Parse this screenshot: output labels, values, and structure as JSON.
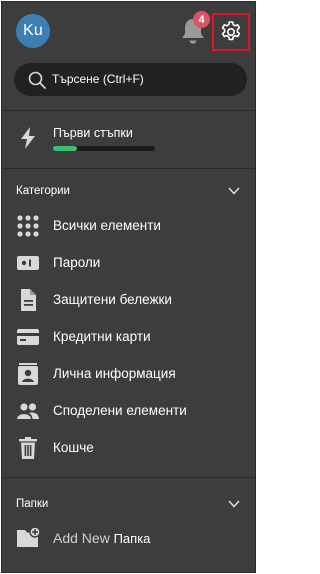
{
  "header": {
    "avatar_initials": "Ku",
    "notifications_count": "4",
    "bell_icon": "bell-icon",
    "settings_icon": "gear-icon"
  },
  "search": {
    "placeholder": "Търсене (Ctrl+F)",
    "icon": "search-icon"
  },
  "getting_started": {
    "label": "Първи стъпки",
    "icon": "lightning-icon",
    "progress_fraction": 0.24
  },
  "categories": {
    "title": "Категории",
    "items": [
      {
        "label": "Всички елементи",
        "icon": "grid-icon"
      },
      {
        "label": "Пароли",
        "icon": "password-icon"
      },
      {
        "label": "Защитени бележки",
        "icon": "note-icon"
      },
      {
        "label": "Кредитни карти",
        "icon": "credit-card-icon"
      },
      {
        "label": "Лична информация",
        "icon": "identity-icon"
      },
      {
        "label": "Споделени елементи",
        "icon": "shared-users-icon"
      },
      {
        "label": "Кошче",
        "icon": "trash-icon"
      }
    ]
  },
  "folders": {
    "title": "Папки",
    "add_new": "Add New",
    "add_new_suffix": "Папка",
    "icon": "folder-add-icon"
  },
  "colors": {
    "panel_bg": "#3d3d3d",
    "search_bg": "#212121",
    "avatar_bg": "#3d7fb3",
    "badge_bg": "#e05260",
    "progress_fill": "#38c172",
    "highlight_border": "#e0142c"
  }
}
